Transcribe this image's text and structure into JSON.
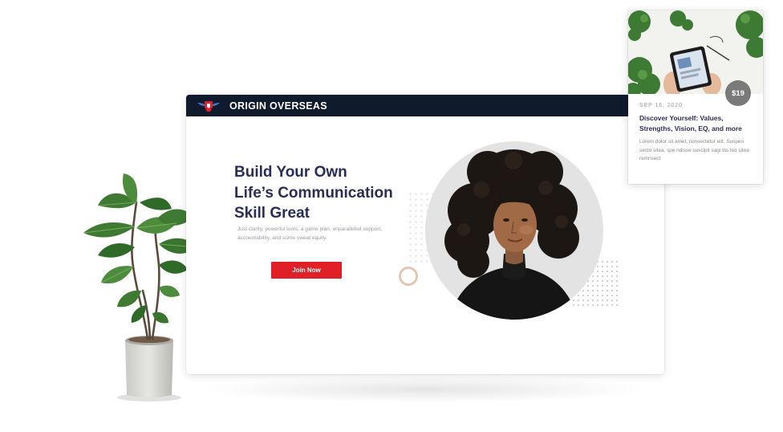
{
  "colors": {
    "nav_bg": "#0f1a2c",
    "title": "#2a2c5a",
    "accent_red": "#e01f26",
    "price_badge": "#7a7a7a"
  },
  "mockup": {
    "brand_name": "ORIGIN OVERSEAS",
    "logo_icon": "winged-shield-logo",
    "hero": {
      "title_lines": [
        "Build Your Own",
        "Life’s Communication",
        "Skill Great"
      ],
      "description": "Just clarity, powerful tools, a game plan, unparalleled support, accountability, and some sweat equity.",
      "cta_label": "Join Now"
    },
    "portrait_alt": "woman-with-curly-hair-portrait"
  },
  "card": {
    "price": "$19",
    "date": "SEP 16, 2020",
    "title": "Discover Yourself: Values, Strengths, Vision, EQ, and more",
    "description": "Lorem dolor sit amet, consectetur elit. Suspen secto sitea. spe ndisse suscipit sagi ttis leo sitea remnsect",
    "image_icon": "tablet-on-desk-photo"
  },
  "decor": {
    "plant_icon": "potted-fiddle-leaf-plant"
  }
}
